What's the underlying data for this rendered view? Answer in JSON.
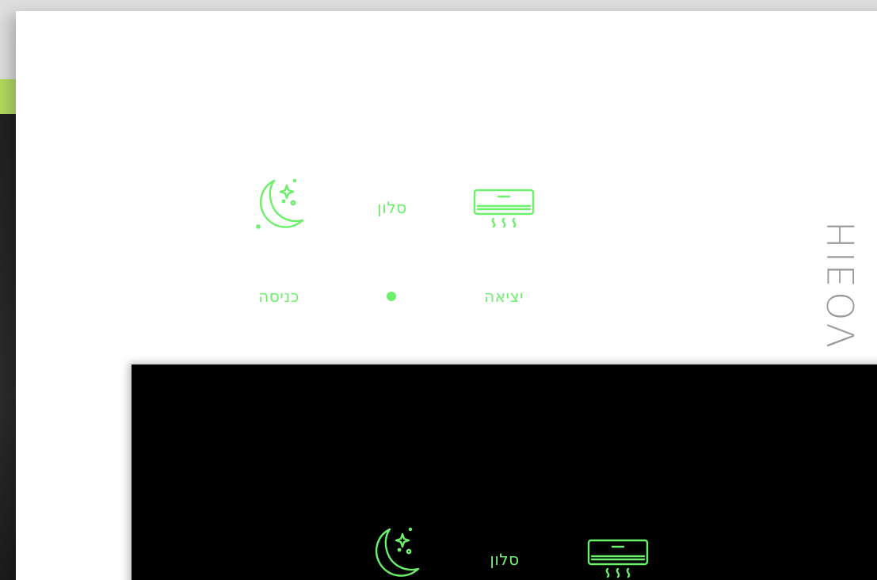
{
  "brand": {
    "logo_text": "VO∃IH"
  },
  "white_panel": {
    "row1": {
      "left_icon": "moon-stars-icon",
      "center_label": "סלון",
      "right_icon": "air-conditioner-icon"
    },
    "row2": {
      "left_label": "כניסה",
      "center_indicator": "dot",
      "right_label": "יציאה"
    }
  },
  "black_panel": {
    "row1": {
      "left_icon": "moon-stars-icon",
      "center_label": "סלון",
      "right_icon": "air-conditioner-icon"
    }
  },
  "colors": {
    "accent": "#6cf06c",
    "panel_white": "#ffffff",
    "panel_black": "#000000",
    "brand_gray": "#9a9a9a"
  }
}
